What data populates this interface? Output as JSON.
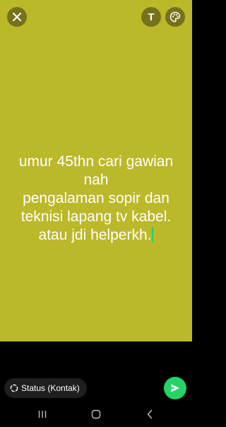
{
  "status_editor": {
    "text_lines": "umur 45thn cari gawian\nnah\npengalaman sopir dan\nteknisi lapang tv kabel.\natau jdi helperkh.",
    "background_color": "#bbb82a",
    "text_color": "#ffffff",
    "cursor_color": "#25d366"
  },
  "toolbar": {
    "close_icon": "close-icon",
    "text_tool_label": "T",
    "palette_icon": "palette-icon"
  },
  "bottom_bar": {
    "audience_label": "Status (Kontak)",
    "audience_icon": "status-ring-icon",
    "send_icon": "send-icon",
    "accent_color": "#25d366"
  },
  "navigation": {
    "recent_icon": "recent-apps-icon",
    "home_icon": "home-icon",
    "back_icon": "back-icon"
  }
}
